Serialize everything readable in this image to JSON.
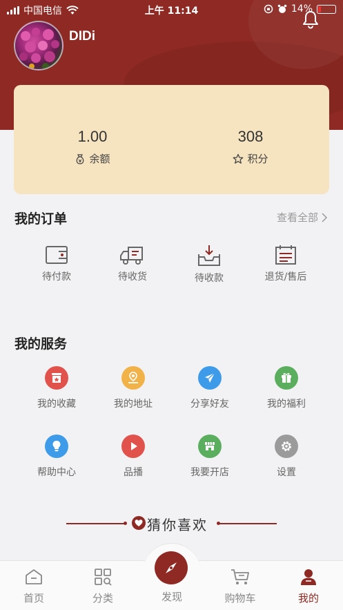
{
  "status_bar": {
    "carrier": "中国电信",
    "time": "上午 11:14",
    "battery": "14%"
  },
  "profile": {
    "username": "DIDi"
  },
  "wallet": {
    "balance_value": "1.00",
    "balance_label": "余额",
    "points_value": "308",
    "points_label": "积分"
  },
  "orders": {
    "title": "我的订单",
    "view_all": "查看全部",
    "items": [
      {
        "label": "待付款",
        "icon": "wallet-icon"
      },
      {
        "label": "待收货",
        "icon": "truck-icon"
      },
      {
        "label": "待收款",
        "icon": "inbox-icon"
      },
      {
        "label": "退货/售后",
        "icon": "receipt-icon"
      }
    ]
  },
  "services": {
    "title": "我的服务",
    "items": [
      {
        "label": "我的收藏",
        "icon": "favorites-icon",
        "color": "#e0524b"
      },
      {
        "label": "我的地址",
        "icon": "location-icon",
        "color": "#f2b24a"
      },
      {
        "label": "分享好友",
        "icon": "share-icon",
        "color": "#3d9be9"
      },
      {
        "label": "我的福利",
        "icon": "gift-icon",
        "color": "#5aae5e"
      },
      {
        "label": "帮助中心",
        "icon": "help-bulb-icon",
        "color": "#3d9be9"
      },
      {
        "label": "品播",
        "icon": "play-icon",
        "color": "#e0524b"
      },
      {
        "label": "我要开店",
        "icon": "store-icon",
        "color": "#5aae5e"
      },
      {
        "label": "设置",
        "icon": "settings-gear-icon",
        "color": "#9b9b9b"
      }
    ]
  },
  "recommend": {
    "title": "猜你喜欢"
  },
  "tabbar": {
    "items": [
      {
        "label": "首页",
        "icon": "home-icon"
      },
      {
        "label": "分类",
        "icon": "category-grid-icon"
      },
      {
        "label": "发现",
        "icon": "compass-icon"
      },
      {
        "label": "购物车",
        "icon": "cart-icon"
      },
      {
        "label": "我的",
        "icon": "user-icon"
      }
    ],
    "active": "我的"
  },
  "colors": {
    "brand": "#8e2923",
    "card": "#f6e3bf",
    "background": "#f2f2f4"
  }
}
